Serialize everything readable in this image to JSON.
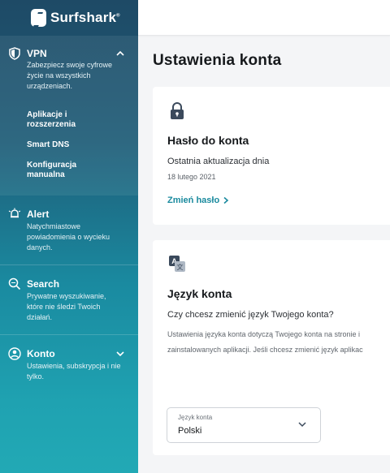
{
  "brand": {
    "name": "Surfshark",
    "mark": "®"
  },
  "sidebar": {
    "vpn": {
      "title": "VPN",
      "desc": "Zabezpiecz swoje cyfrowe życie na wszystkich urządzeniach.",
      "items": [
        {
          "label": "Aplikacje i rozszerzenia"
        },
        {
          "label": "Smart DNS"
        },
        {
          "label": "Konfiguracja manualna"
        }
      ]
    },
    "alert": {
      "title": "Alert",
      "desc": "Natychmiastowe powiadomienia o wycieku danych."
    },
    "search": {
      "title": "Search",
      "desc": "Prywatne wyszukiwanie, które nie śledzi Twoich działań."
    },
    "account": {
      "title": "Konto",
      "desc": "Ustawienia, subskrypcja i nie tylko."
    }
  },
  "main": {
    "title": "Ustawienia konta",
    "password_card": {
      "title": "Hasło do konta",
      "updated_label": "Ostatnia aktualizacja dnia",
      "updated_date": "18 lutego 2021",
      "change_link": "Zmień hasło"
    },
    "language_card": {
      "title": "Język konta",
      "question": "Czy chcesz zmienić język Twojego konta?",
      "info_line1": "Ustawienia języka konta dotyczą Twojego konta na stronie i",
      "info_line2": "zainstalowanych aplikacji. Jeśli chcesz zmienić język aplikac",
      "select_label": "Język konta",
      "select_value": "Polski"
    }
  }
}
